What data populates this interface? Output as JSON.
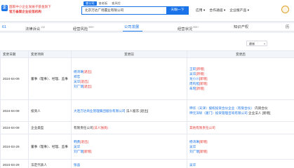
{
  "header": {
    "logo_text": "企",
    "promo_line1": "国家中小企业发展子基金旗下",
    "promo_line2": "官方备案企业征信机构",
    "search_tabs": [
      "查公司",
      "查老板",
      "查风险"
    ],
    "search_value": "北京万达广场置业有限公司",
    "search_button": "天眼一下",
    "nav": [
      "应用 ▾",
      "合作通道 ▾",
      "企业版产品 ▾"
    ]
  },
  "section_tabs": [
    {
      "label": "61",
      "count": ""
    },
    {
      "label": "法律诉讼",
      "count": "132"
    },
    {
      "label": "经营风险",
      "count": "999+"
    },
    {
      "label": "公司发展",
      "count": ""
    },
    {
      "label": "经营状况",
      "count": "999+"
    },
    {
      "label": "知识产权",
      "count": ""
    },
    {
      "label": "历",
      "count": ""
    }
  ],
  "sort_label": "最新",
  "table": {
    "headers": [
      "变更日期",
      "变更项目",
      "变更前",
      "变更后"
    ],
    "rows": [
      {
        "date": "2024-04-09",
        "item": "董事（理事）、经理、监事",
        "before": [
          {
            "name": "杨湾琳",
            "tag": "[退出]"
          },
          {
            "name": "郑忠",
            "tag": ""
          },
          {
            "name": "吴华",
            "tag": "[退出]"
          },
          {
            "name": "刘广瑞",
            "tag": "[退出]"
          }
        ],
        "after": [
          {
            "name": "王轩",
            "tag": "[新增]"
          },
          {
            "name": "吴华",
            "tag": "[新增]"
          },
          {
            "name": "龙小川",
            "tag": "[新增]"
          },
          {
            "name": "周鸣旭",
            "tag": "[新增]"
          },
          {
            "name": "朱瑶",
            "tag": "[新增]"
          }
        ]
      },
      {
        "date": "2024-04-09",
        "item": "投资人",
        "before": [
          {
            "name": "大连万达商业管理集团股份有限公司",
            "tag": "法人股东 [退出]"
          }
        ],
        "after": [
          {
            "name": "珅华（天津）股权投资合伙企业（有限合伙）",
            "tag": "内资合伙"
          },
          {
            "name": "珅元深圳（厦门）投资管理咨询有限公司",
            "tag": "企业法人 [新增]"
          }
        ]
      },
      {
        "date": "2024-04-09",
        "item": "企业类型",
        "before": [
          {
            "name": "有限责任公司",
            "tag": "(法人独资)"
          }
        ],
        "after": [
          {
            "name": "其他有限责任公司",
            "tag": ""
          }
        ]
      },
      {
        "date": "2024-03-29",
        "item": "董事（理事）、经理、监事",
        "before": [
          {
            "name": "韩勇",
            "tag": "[退出]"
          },
          {
            "name": "吴华",
            "tag": ""
          },
          {
            "name": "刘广瑞",
            "tag": "[新增]"
          }
        ],
        "after": [
          {
            "name": "杨湾琳",
            "tag": "[新增]"
          },
          {
            "name": "吴华",
            "tag": ""
          },
          {
            "name": "刘广瑞",
            "tag": "[新增]"
          }
        ]
      },
      {
        "date": "2024-03-29",
        "item": "法定代表人",
        "before": [
          {
            "name": "张晶",
            "tag": ""
          }
        ],
        "after": [
          {
            "name": "吴华",
            "tag": ""
          }
        ]
      }
    ]
  }
}
